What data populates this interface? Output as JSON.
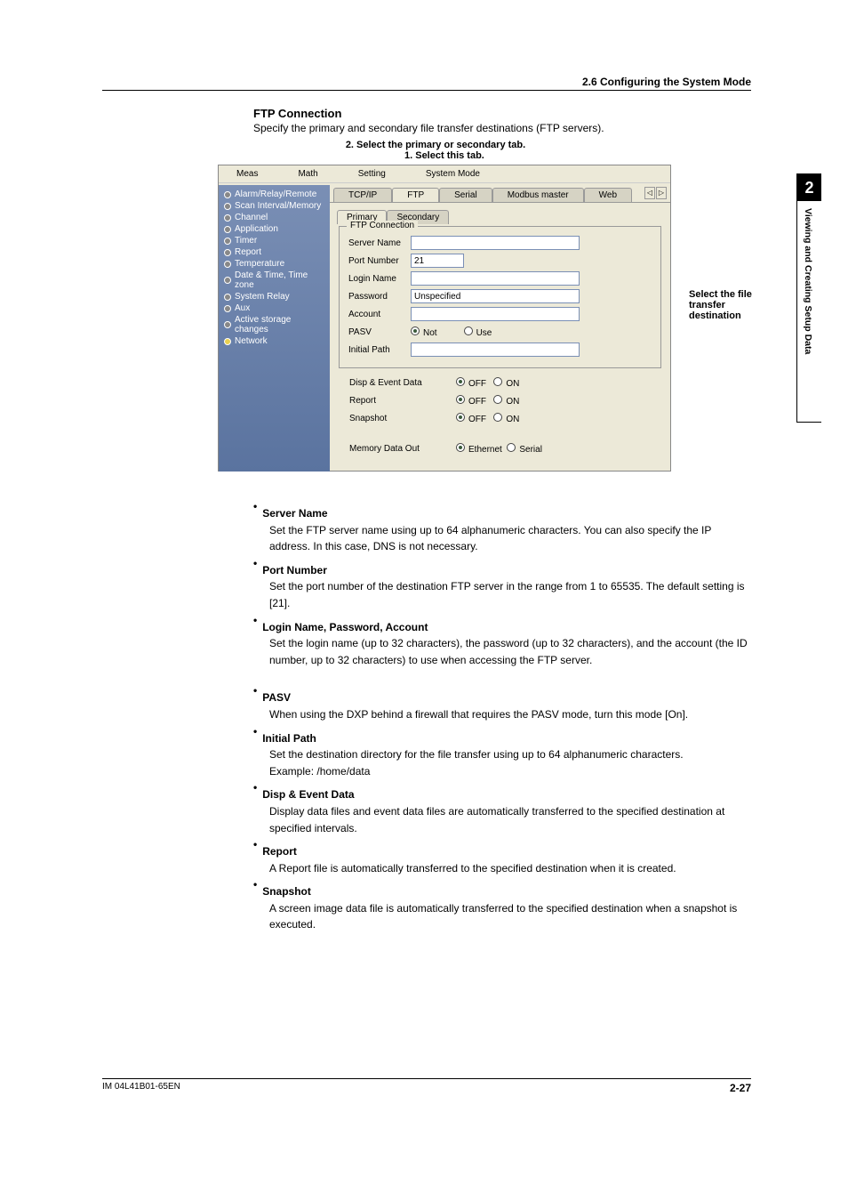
{
  "header": {
    "section": "2.6  Configuring the System Mode"
  },
  "chapter": {
    "num": "2",
    "name": "Viewing and Creating Setup Data"
  },
  "section_title": "FTP Connection",
  "lead": "Specify the primary and secondary file transfer destinations (FTP servers).",
  "callouts": {
    "top2": "2. Select the primary or secondary tab.",
    "top1": "1. Select this tab.",
    "right": "Select the file transfer destination"
  },
  "screenshot": {
    "menu": {
      "meas": "Meas",
      "math": "Math",
      "setting": "Setting",
      "system_mode": "System Mode"
    },
    "tree": [
      "Alarm/Relay/Remote",
      "Scan Interval/Memory",
      "Channel",
      "Application",
      "Timer",
      "Report",
      "Temperature",
      "Date & Time, Time zone",
      "System Relay",
      "Aux",
      "Active storage changes",
      "Network"
    ],
    "toptabs": {
      "tcpip": "TCP/IP",
      "ftp": "FTP",
      "serial": "Serial",
      "modbus": "Modbus master",
      "web": "Web"
    },
    "subtabs": {
      "primary": "Primary",
      "secondary": "Secondary"
    },
    "group_title": "FTP Connection",
    "labels": {
      "server_name": "Server Name",
      "port_number": "Port Number",
      "login_name": "Login Name",
      "password": "Password",
      "account": "Account",
      "pasv": "PASV",
      "initial_path": "Initial Path",
      "disp_event": "Disp & Event Data",
      "report": "Report",
      "snapshot": "Snapshot",
      "memory_out": "Memory Data Out"
    },
    "values": {
      "port_number": "21",
      "password": "Unspecified"
    },
    "radios": {
      "not": "Not",
      "use": "Use",
      "off": "OFF",
      "on": "ON",
      "ethernet": "Ethernet",
      "serial": "Serial"
    }
  },
  "body": {
    "server_name_h": "Server Name",
    "server_name_t": "Set the FTP server name using up to 64 alphanumeric characters. You can also specify the IP address. In this case, DNS is not necessary.",
    "port_h": "Port Number",
    "port_t": "Set the port number of the destination FTP server in the range from 1 to 65535. The default setting is [21].",
    "login_h": "Login Name, Password, Account",
    "login_t": "Set the login name (up to 32 characters), the password (up to 32 characters), and  the account (the ID number, up to 32 characters) to use when accessing the FTP server.",
    "pasv_h": "PASV",
    "pasv_t": "When using the DXP behind a firewall that requires the PASV mode, turn this mode [On].",
    "initial_h": "Initial Path",
    "initial_t1": "Set the destination directory for the file transfer using up to 64 alphanumeric characters.",
    "initial_t2": "Example:   /home/data",
    "disp_h": "Disp & Event Data",
    "disp_t": "Display data files and event data files are automatically transferred to the specified destination at specified intervals.",
    "report_h": "Report",
    "report_t": "A Report file is automatically transferred to the specified destination when it is created.",
    "snap_h": "Snapshot",
    "snap_t": "A screen image data file is automatically transferred to the specified destination when a snapshot is executed."
  },
  "footer": {
    "doc_id": "IM 04L41B01-65EN",
    "page": "2-27"
  }
}
